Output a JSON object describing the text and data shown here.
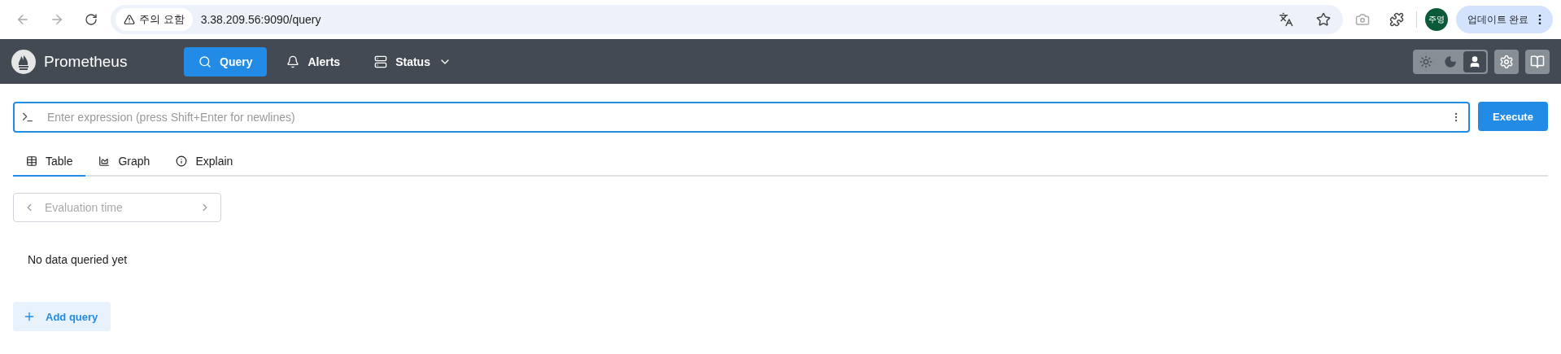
{
  "browser": {
    "security_chip": "주의 요함",
    "url": "3.38.209.56:9090/query",
    "profile": "주영",
    "update_button": "업데이트 완료"
  },
  "navbar": {
    "brand": "Prometheus",
    "items": [
      {
        "label": "Query",
        "selected": true,
        "kind": "query"
      },
      {
        "label": "Alerts",
        "selected": false,
        "kind": "alerts"
      },
      {
        "label": "Status",
        "selected": false,
        "kind": "status"
      }
    ],
    "theme_toggle": [
      {
        "kind": "light",
        "selected": false
      },
      {
        "kind": "dark",
        "selected": false
      },
      {
        "kind": "auto",
        "selected": true
      }
    ]
  },
  "expression": {
    "placeholder": "Enter expression (press Shift+Enter for newlines)"
  },
  "execute_button": "Execute",
  "tabs": [
    {
      "label": "Table",
      "selected": true,
      "kind": "table"
    },
    {
      "label": "Graph",
      "selected": false,
      "kind": "graph"
    },
    {
      "label": "Explain",
      "selected": false,
      "kind": "explain"
    }
  ],
  "evaluation_time": {
    "placeholder": "Evaluation time"
  },
  "empty_message": "No data queried yet",
  "add_query_button": "Add query"
}
